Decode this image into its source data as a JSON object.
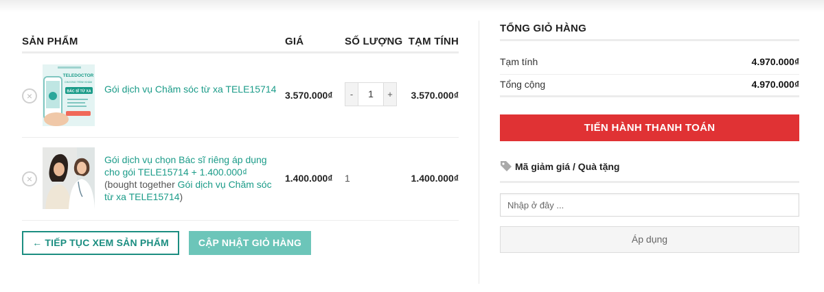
{
  "table": {
    "headers": {
      "product": "SẢN PHẨM",
      "price": "GIÁ",
      "quantity": "SỐ LƯỢNG",
      "subtotal": "TẠM TÍNH"
    },
    "rows": [
      {
        "remove_glyph": "×",
        "name": "Gói dịch vụ Chăm sóc từ xa TELE15714",
        "price": "3.570.000₫",
        "quantity": "1",
        "qty_minus": "-",
        "qty_plus": "+",
        "subtotal": "3.570.000₫",
        "thumb": {
          "brand": "TELEDOCTOR",
          "line1": "CHƯƠNG TRÌNH KHÁM",
          "line2": "BÁC SĨ TỪ XA"
        }
      },
      {
        "remove_glyph": "×",
        "name": "Gói dịch vụ chọn Bác sĩ riêng áp dụng cho gói TELE15714 + 1.400.000₫",
        "bought_together_prefix": "(bought together ",
        "bought_together_link": "Gói dịch vụ Chăm sóc từ xa TELE15714",
        "bought_together_suffix": ")",
        "price": "1.400.000₫",
        "quantity": "1",
        "subtotal": "1.400.000₫"
      }
    ]
  },
  "actions": {
    "continue_label": "← TIẾP TỤC XEM SẢN PHẨM",
    "update_label": "CẬP NHẬT GIỎ HÀNG"
  },
  "totals": {
    "title": "TỔNG GIỎ HÀNG",
    "subtotal_label": "Tạm tính",
    "subtotal_value": "4.970.000₫",
    "total_label": "Tổng cộng",
    "total_value": "4.970.000₫",
    "checkout_label": "TIẾN HÀNH THANH TOÁN"
  },
  "coupon": {
    "title": "Mã giảm giá / Quà tặng",
    "placeholder": "Nhập ở đây ...",
    "apply_label": "Áp dụng"
  },
  "colors": {
    "accent_teal": "#1a8d80",
    "link_teal": "#1a9b88",
    "update_button": "#6cc5b9",
    "checkout_red": "#e03234"
  }
}
